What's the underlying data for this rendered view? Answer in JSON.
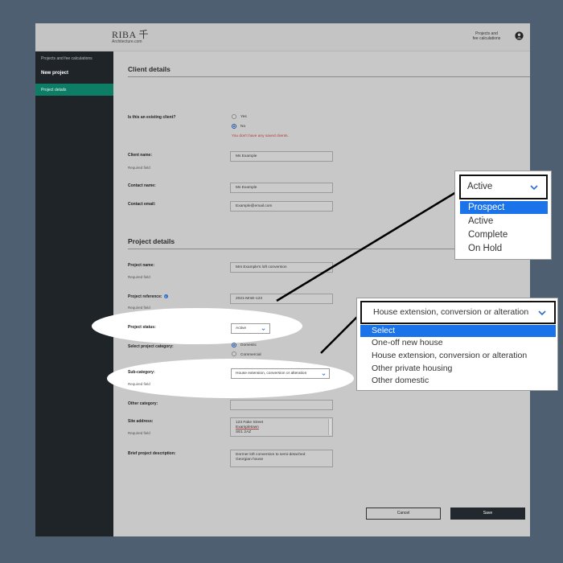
{
  "header": {
    "logo_text": "RIBA 千",
    "logo_sub": "Architecture.com",
    "link_line1": "Projects and",
    "link_line2": "fee calculations"
  },
  "sidebar": {
    "crumb": "Projects and fee calculations",
    "new_project": "New project",
    "active_item": "Project details"
  },
  "client": {
    "title": "Client details",
    "existing_label": "Is this an existing client?",
    "yes": "Yes",
    "no": "No",
    "error": "You don't have any saved clients.",
    "client_name_label": "Client name:",
    "client_name_value": "Ms Example",
    "required": "Required field",
    "contact_name_label": "Contact name:",
    "contact_name_value": "Ms Example",
    "contact_email_label": "Contact email:",
    "contact_email_value": "Example@email.com"
  },
  "project": {
    "title": "Project details",
    "name_label": "Project name:",
    "name_value": "Mrs Example's loft conversion",
    "ref_label": "Project reference:",
    "ref_value": "2021-MrsE-123",
    "status_label": "Project status:",
    "status_value": "Active",
    "category_label": "Select project category:",
    "domestic": "Domestic",
    "commercial": "Commercial",
    "subcat_label": "Sub-category:",
    "subcat_value": "House extension, conversion or alteration",
    "other_label": "Other category:",
    "site_label": "Site address:",
    "site_line1": "123 Fake Street",
    "site_line2": "Exampletown",
    "site_line3": "SE1 2AZ",
    "brief_label": "Brief project description:",
    "brief_line1": "Dormer loft conversion to semi-detached",
    "brief_line2": "Georgian house"
  },
  "actions": {
    "cancel": "Cancel",
    "save": "Save"
  },
  "status_callout": {
    "selected": "Active",
    "options": [
      "Prospect",
      "Active",
      "Complete",
      "On Hold"
    ]
  },
  "subcat_callout": {
    "selected": "House extension, conversion or alteration",
    "options": [
      "Select",
      "One-off new house",
      "House extension, conversion or alteration",
      "Other private housing",
      "Other domestic"
    ]
  },
  "colors": {
    "sidebar_active": "#0d7d66",
    "highlight": "#1a73e8",
    "error": "#b33a3a"
  }
}
